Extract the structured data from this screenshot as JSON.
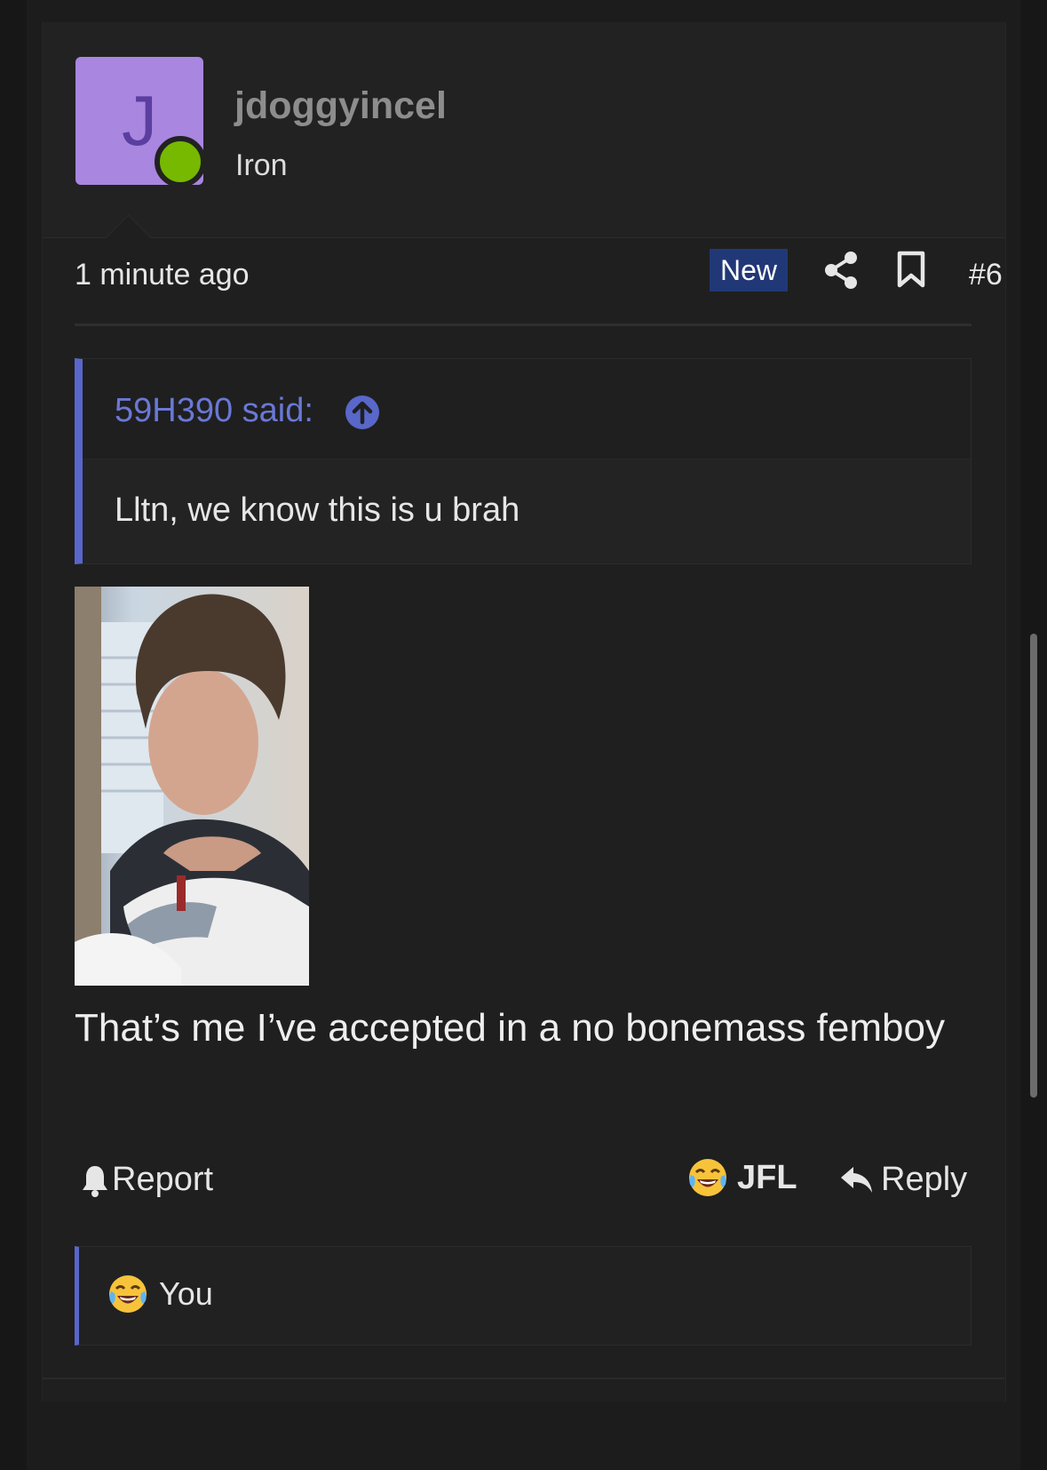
{
  "post": {
    "username": "jdoggyincel",
    "avatar_letter": "J",
    "user_title": "Iron",
    "timestamp": "1 minute ago",
    "new_badge": "New",
    "post_number": "#6",
    "quote": {
      "author_label": "59H390 said:",
      "text": "Lltn, we know this is u brah"
    },
    "body_text": "That’s me I’ve accepted in a no bonemass femboy",
    "actions": {
      "report_label": "Report",
      "jfl_label": "JFL",
      "reply_label": "Reply"
    },
    "reactions": {
      "summary_label": "You"
    }
  },
  "colors": {
    "accent": "#5867c9",
    "avatar_bg": "#a986e0",
    "online": "#76b900",
    "new_badge_bg": "#213877"
  },
  "icons": [
    "share-icon",
    "bookmark-icon",
    "arrow-up-circle-icon",
    "bell-icon",
    "laughing-crying-emoji-icon",
    "reply-arrow-icon"
  ]
}
